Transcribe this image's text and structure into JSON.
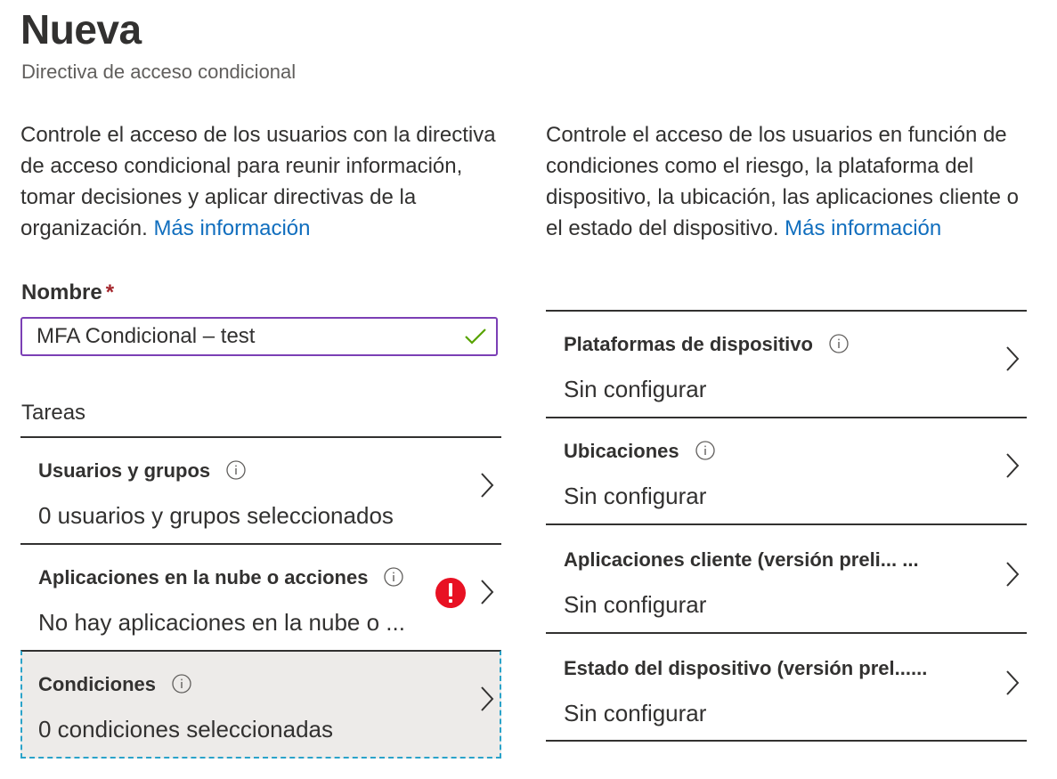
{
  "header": {
    "title": "Nueva",
    "subtitle": "Directiva de acceso condicional"
  },
  "left_description": {
    "text": "Controle el acceso de los usuarios con la directiva de acceso condicional para reunir información, tomar decisiones y aplicar directivas de la organización. ",
    "link": "Más información"
  },
  "right_description": {
    "text": "Controle el acceso de los usuarios en función de condiciones como el riesgo, la plataforma del dispositivo, la ubicación, las aplicaciones cliente o el estado del dispositivo. ",
    "link": "Más información"
  },
  "name_field": {
    "label": "Nombre",
    "required_mark": "*",
    "value": "MFA Condicional – test"
  },
  "tasks": {
    "label": "Tareas",
    "items": [
      {
        "title": "Usuarios y grupos",
        "value": "0 usuarios y grupos seleccionados",
        "error": false
      },
      {
        "title": "Aplicaciones en la nube o acciones",
        "value": "No hay aplicaciones en la nube o ...",
        "error": true
      },
      {
        "title": "Condiciones",
        "value": "0 condiciones seleccionadas",
        "error": false,
        "selected": true
      }
    ]
  },
  "conditions": {
    "items": [
      {
        "title": "Plataformas de dispositivo",
        "value": "Sin configurar",
        "has_info": true
      },
      {
        "title": "Ubicaciones",
        "value": "Sin configurar",
        "has_info": true
      },
      {
        "title": "Aplicaciones cliente (versión preli...   ...",
        "value": "Sin configurar",
        "has_info": false
      },
      {
        "title": "Estado del dispositivo (versión prel......",
        "value": "Sin configurar",
        "has_info": false
      }
    ]
  },
  "colors": {
    "accent_link": "#106ebe",
    "input_border": "#7b3fb5",
    "valid_check": "#57a300",
    "error": "#e81123",
    "selection_border": "#2ba3c9"
  },
  "icons": [
    "info-icon",
    "chevron-right-icon",
    "checkmark-icon",
    "error-icon"
  ]
}
